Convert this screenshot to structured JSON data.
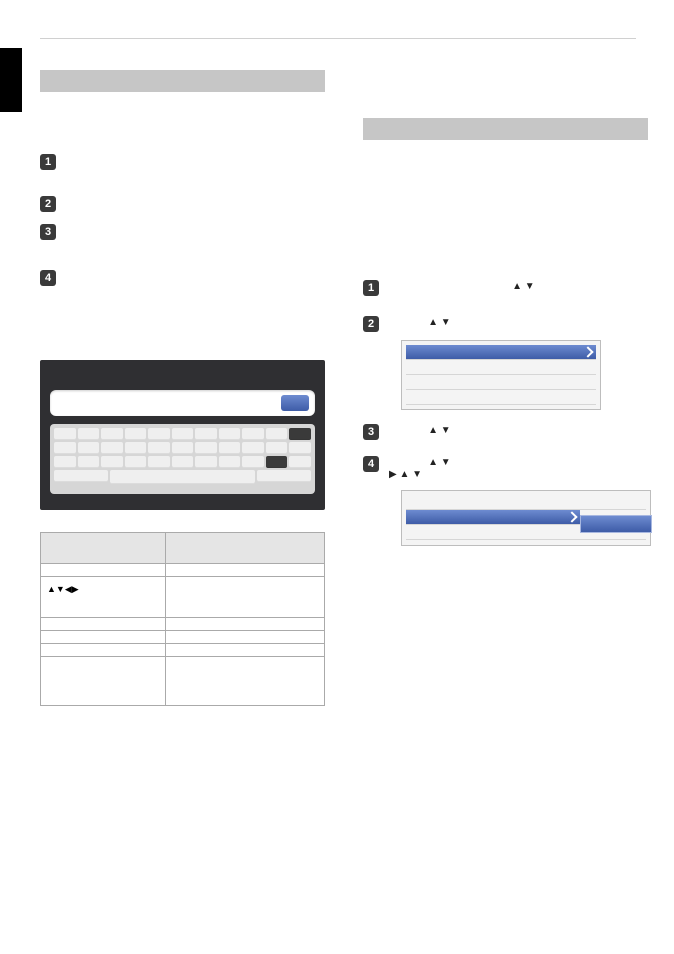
{
  "left": {
    "section_title": "",
    "steps": [
      {
        "n": "1",
        "text": ""
      },
      {
        "n": "2",
        "text": ""
      },
      {
        "n": "3",
        "text": ""
      },
      {
        "n": "4",
        "text": ""
      }
    ],
    "kb_caption_left": "",
    "kb_caption_right": "",
    "table": {
      "headers": [
        "",
        ""
      ],
      "rows": [
        {
          "c1": "",
          "c2": ""
        },
        {
          "c1_glyph": "▲▼◀▶",
          "c1": "",
          "c2": ""
        },
        {
          "c1": "",
          "c2": ""
        },
        {
          "c1": "",
          "c2": ""
        },
        {
          "c1": "",
          "c2": ""
        },
        {
          "c1": "",
          "c2": ""
        }
      ]
    }
  },
  "right": {
    "section_title": "",
    "steps": [
      {
        "n": "1",
        "text": "",
        "glyph": "▲ ▼"
      },
      {
        "n": "2",
        "text": "",
        "glyph": "▲ ▼"
      },
      {
        "n": "3",
        "text": "",
        "glyph": "▲ ▼"
      },
      {
        "n": "4",
        "text": "",
        "glyph_top": "▲ ▼",
        "glyph_bottom": "▶   ▲ ▼"
      }
    ]
  }
}
